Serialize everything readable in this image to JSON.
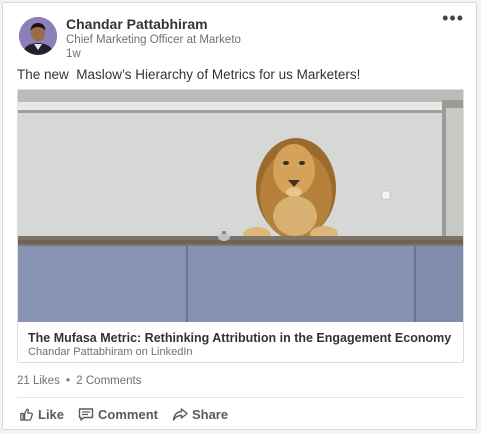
{
  "post": {
    "author_name": "Chandar Pattabhiram",
    "author_title": "Chief Marketing Officer at Marketo",
    "age": "1w",
    "more_icon": "•••",
    "text": "The new  Maslow’s Hierarchy of Metrics for us Marketers!"
  },
  "share": {
    "title": "The Mufasa Metric: Rethinking Attribution in the Engagement Economy",
    "source": "Chandar Pattabhiram on LinkedIn"
  },
  "social": {
    "likes": "21 Likes",
    "separator": "•",
    "comments": "2 Comments"
  },
  "actions": {
    "like": "Like",
    "comment": "Comment",
    "share": "Share"
  },
  "icons": {
    "more": "more-options-icon",
    "like": "thumbs-up-icon",
    "comment": "comment-icon",
    "share": "share-arrow-icon"
  },
  "colors": {
    "text_primary": "#333333",
    "text_secondary": "#707070",
    "action_text": "#5a5a5a",
    "border": "#d7d7d7"
  }
}
